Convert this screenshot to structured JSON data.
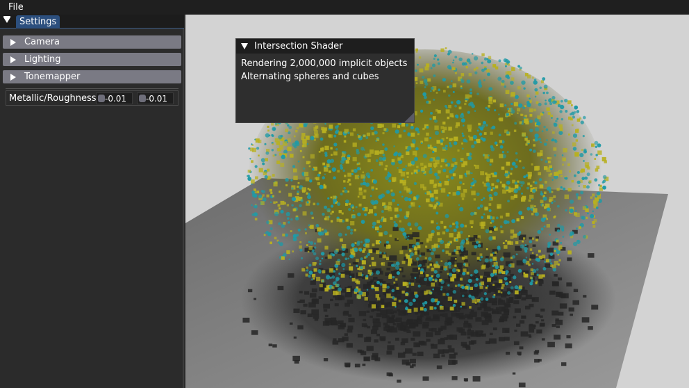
{
  "menubar": {
    "items": [
      "File"
    ]
  },
  "settings_panel": {
    "tab": "Settings",
    "sections": [
      "Camera",
      "Lighting",
      "Tonemapper"
    ],
    "metallic_roughness": {
      "label": "Metallic/Roughness Override",
      "values": [
        "-0.01",
        "-0.01"
      ]
    }
  },
  "overlay": {
    "title": "Intersection Shader",
    "lines": [
      "Rendering 2,000,000 implicit objects",
      "Alternating spheres and cubes"
    ]
  },
  "scene_colors": {
    "background": "#d3d3d3",
    "floor": "#7d7d7d",
    "cube": "#b8b020",
    "sphere": "#1f9aa6",
    "shadow": "#262626"
  }
}
